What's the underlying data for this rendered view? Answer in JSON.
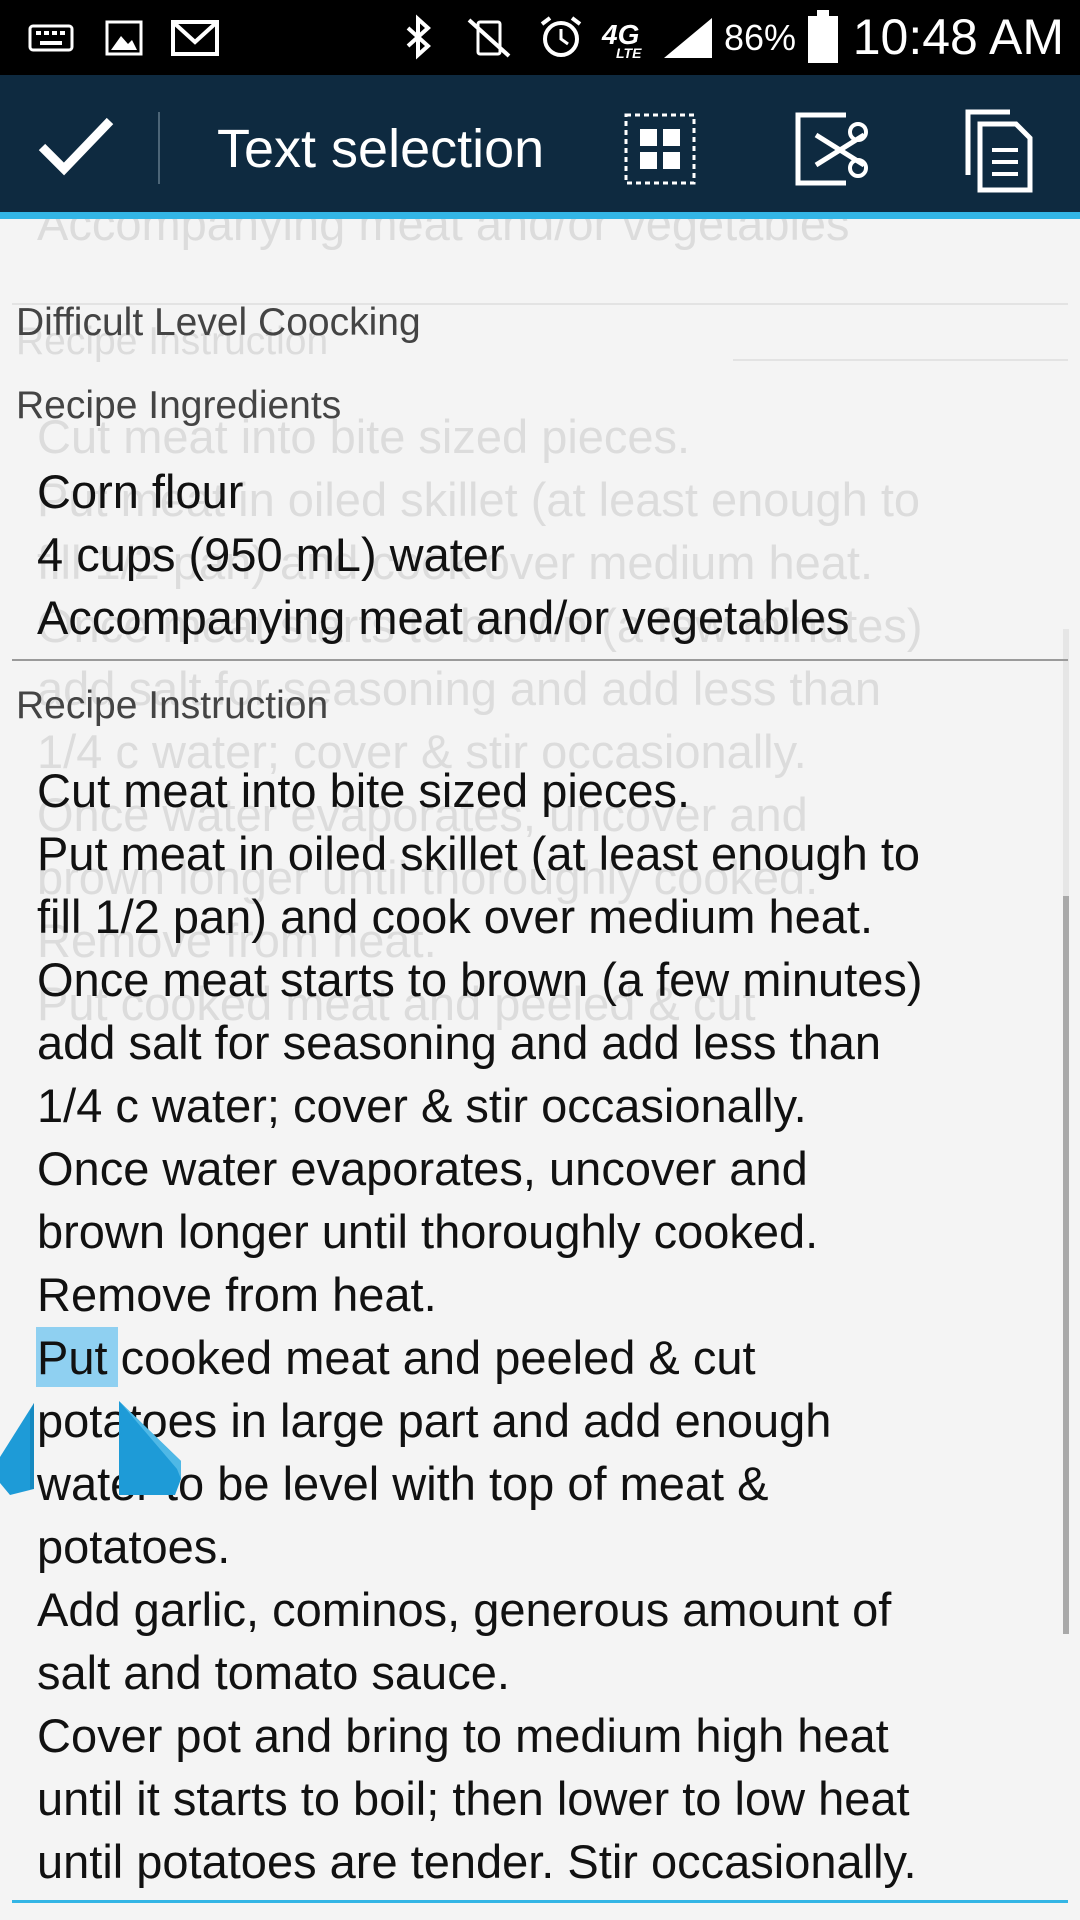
{
  "status_bar": {
    "battery_percent": "86%",
    "time": "10:48 AM",
    "icons": [
      "keyboard-icon",
      "image-icon",
      "gmail-icon",
      "bluetooth-icon",
      "vibrate-mute-icon",
      "alarm-icon",
      "lte-4g-icon",
      "signal-icon",
      "battery-icon"
    ]
  },
  "action_bar": {
    "title": "Text selection",
    "actions": [
      "done-check-icon",
      "select-all-icon",
      "cut-icon",
      "copy-icon"
    ]
  },
  "ghost_text": {
    "top_line": "Accompanying meat and/or vegetables",
    "label_shadow": "Recipe Instruction",
    "lines": [
      "Cut meat into bite sized pieces.",
      "Put meat in oiled skillet (at least enough to",
      "fill 1/2 pan) and cook over medium heat.",
      "Once meat starts to brown (a few minutes)",
      "add salt for seasoning and add less than",
      "1/4 c water; cover & stir occasionally.",
      "Once water evaporates, uncover and",
      "brown longer until thoroughly cooked.",
      "Remove from heat.",
      "Put cooked meat and peeled & cut"
    ]
  },
  "form": {
    "difficulty_label": "Difficult Level Coocking",
    "ingredients_label": "Recipe Ingredients",
    "ingredients": [
      "Corn flour",
      "4 cups (950 mL) water",
      "Accompanying meat and/or vegetables"
    ],
    "instruction_label": "Recipe Instruction",
    "instructions": [
      "Cut meat into bite sized pieces.",
      "Put meat in oiled skillet (at least enough to",
      "fill 1/2 pan) and cook over medium heat.",
      "Once meat starts to brown (a few minutes)",
      "add salt for seasoning and add less than",
      "1/4 c water; cover & stir occasionally.",
      "Once water evaporates, uncover and",
      "brown longer until thoroughly cooked.",
      "Remove from heat.",
      "Put cooked meat and peeled & cut",
      "potatoes in large part and add enough",
      "water to be level with top of meat &",
      "potatoes.",
      "Add garlic, cominos, generous amount of",
      "salt and tomato sauce.",
      "Cover pot and bring to medium high heat",
      "until it starts to boil; then lower to low heat",
      "until potatoes are tender. Stir occasionally."
    ],
    "selected_text": "Put"
  },
  "colors": {
    "action_bar": "#0e2a40",
    "accent": "#33b5e5",
    "selection": "#8fd0f1",
    "handle": "#1e9bd7"
  }
}
